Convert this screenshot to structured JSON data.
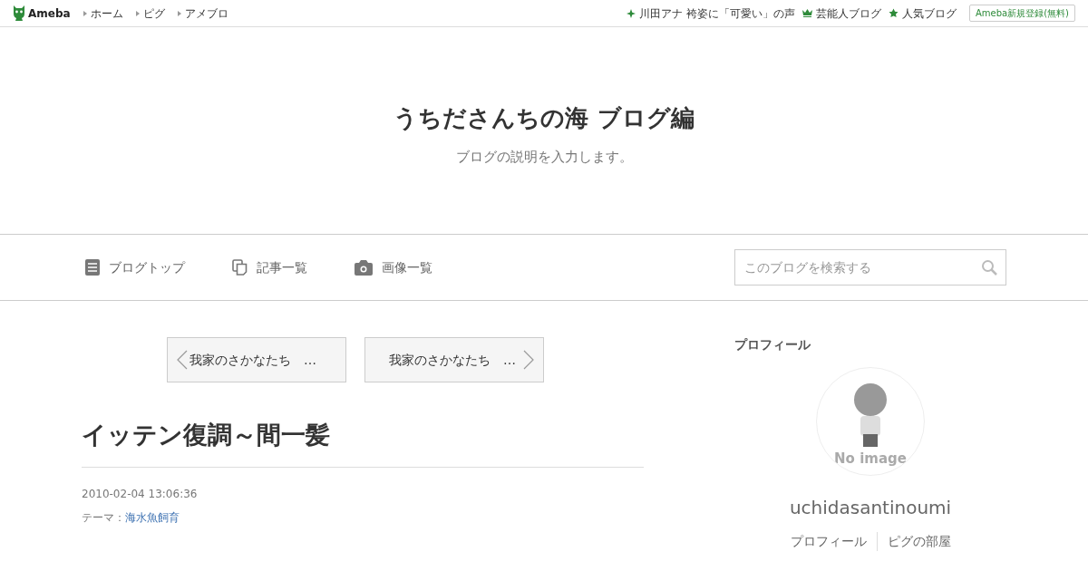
{
  "topbar": {
    "logo": "Ameba",
    "links": [
      "ホーム",
      "ピグ",
      "アメブロ"
    ],
    "right_links": [
      {
        "kind": "sparkle",
        "label": "川田アナ 袴姿に「可愛い」の声"
      },
      {
        "kind": "crown",
        "label": "芸能人ブログ"
      },
      {
        "kind": "star",
        "label": "人気ブログ"
      }
    ],
    "register": "Ameba新規登録(無料)"
  },
  "header": {
    "title": "うちださんちの海 ブログ編",
    "description": "ブログの説明を入力します。"
  },
  "nav": {
    "items": [
      {
        "kind": "doc",
        "label": "ブログトップ"
      },
      {
        "kind": "copy",
        "label": "記事一覧"
      },
      {
        "kind": "camera",
        "label": "画像一覧"
      }
    ],
    "search_placeholder": "このブログを検索する"
  },
  "pager": {
    "prev": "我家のさかなたち　…",
    "next": "我家のさかなたち　…"
  },
  "article": {
    "title": "イッテン復調～間一髪",
    "date": "2010-02-04 13:06:36",
    "theme_label": "テーマ：",
    "theme": "海水魚飼育"
  },
  "profile": {
    "heading": "プロフィール",
    "avatar_caption": "No image",
    "name": "uchidasantinoumi",
    "links": [
      "プロフィール",
      "ピグの部屋"
    ]
  }
}
